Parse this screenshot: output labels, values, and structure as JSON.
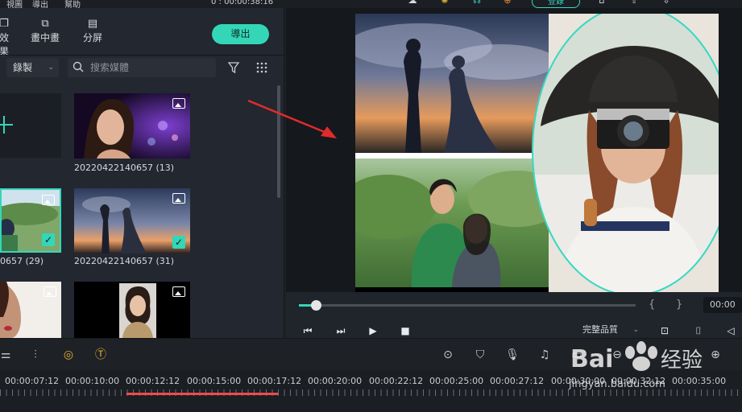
{
  "menubar": {
    "items": [
      "視圖",
      "導出",
      "幫助"
    ],
    "time": "0 : 00:00:38:16",
    "login_label": "登錄",
    "icons": [
      "cloud-icon",
      "bulb-icon",
      "headset-icon",
      "cart-icon",
      "save-icon",
      "upload-icon",
      "download-icon"
    ]
  },
  "toolbar": {
    "effects_label": "效果",
    "pip_label": "畫中畫",
    "split_label": "分屏",
    "export_label": "導出"
  },
  "media": {
    "record_label": "錄製",
    "search_placeholder": "搜索媒體",
    "items": [
      {
        "label": "20220422140657 (13)"
      },
      {
        "label": "0657 (29)"
      },
      {
        "label": "20220422140657 (31)"
      }
    ]
  },
  "player": {
    "quality_label": "完整品質",
    "time_display": "00:00",
    "progress": 0.05
  },
  "timeline": {
    "ticks": [
      "00:00:07:12",
      "00:00:10:00",
      "00:00:12:12",
      "00:00:15:00",
      "00:00:17:12",
      "00:00:20:00",
      "00:00:22:12",
      "00:00:25:00",
      "00:00:27:12",
      "00:00:30:00",
      "00:00:32:12",
      "00:00:35:00"
    ]
  },
  "watermark": {
    "brand": "Bai",
    "brand2": "经验",
    "url": "jingyan.baidu.com"
  },
  "colors": {
    "accent": "#33d7b8",
    "arrow": "#e02b2b",
    "redline": "#f04b4b"
  }
}
